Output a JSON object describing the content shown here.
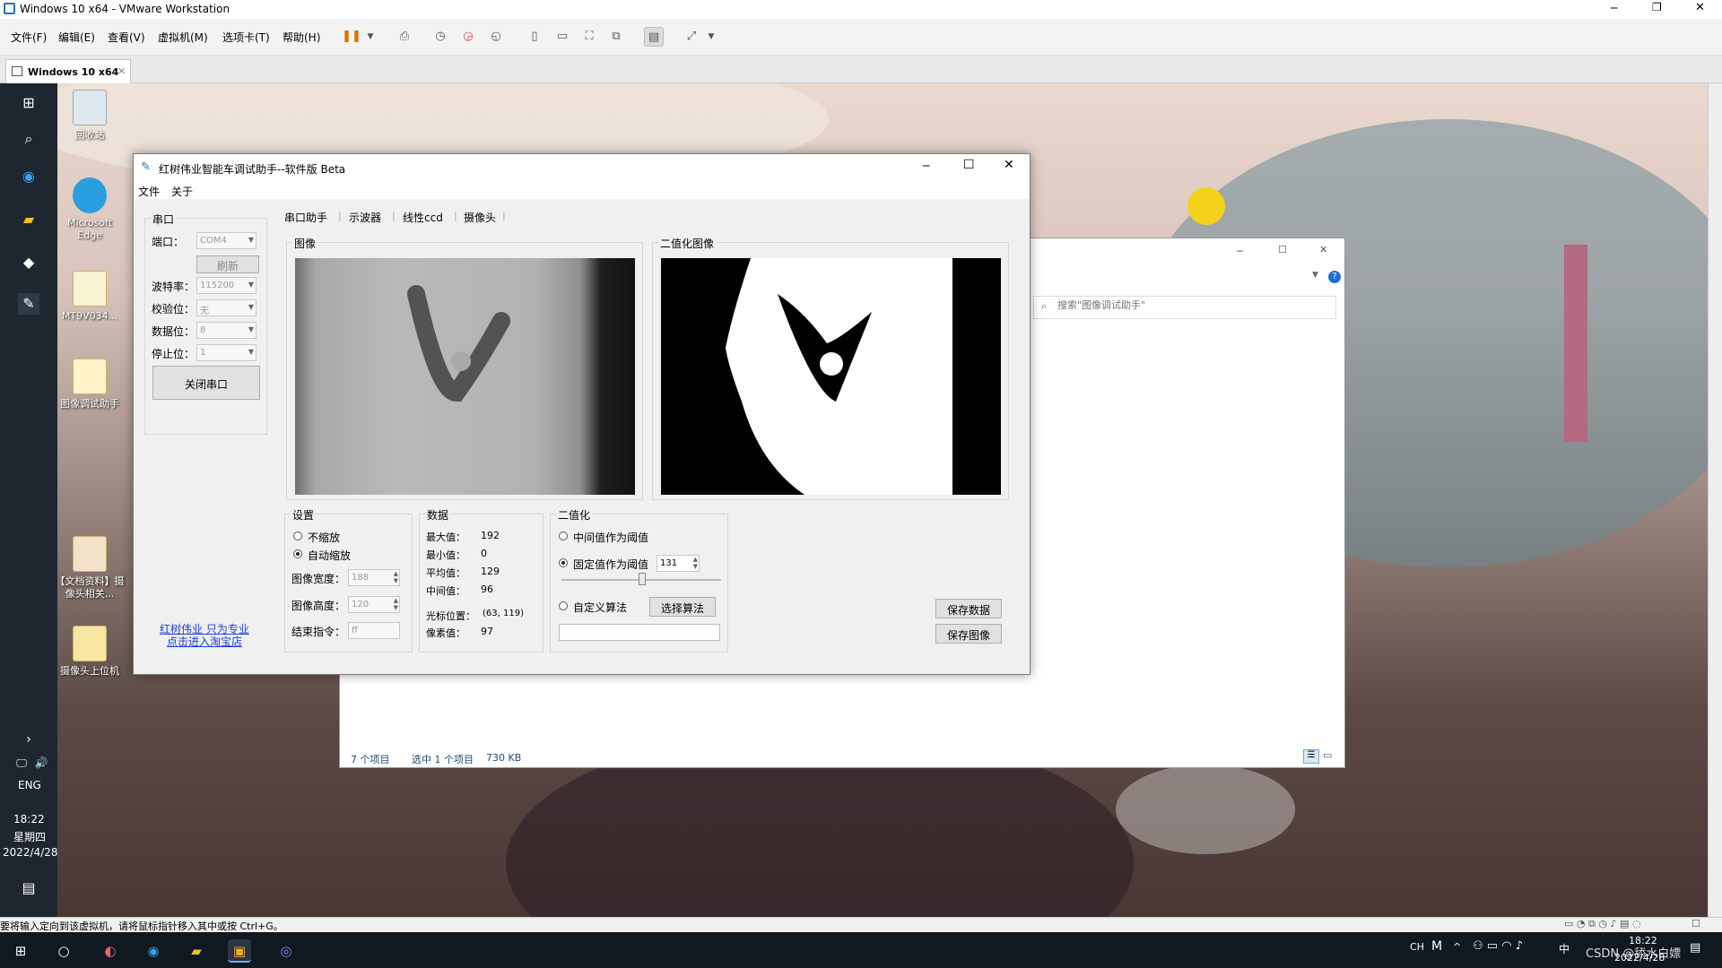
{
  "host": {
    "title": "Windows 10 x64 - VMware Workstation",
    "menu": [
      "文件(F)",
      "编辑(E)",
      "查看(V)",
      "虚拟机(M)",
      "选项卡(T)",
      "帮助(H)"
    ],
    "tab_label": "Windows 10 x64",
    "status_text": "要将输入定向到该虚拟机，请将鼠标指针移入其中或按 Ctrl+G。"
  },
  "guest": {
    "side_lang": "ENG",
    "side_time": "18:22",
    "side_weekday": "星期四",
    "side_date": "2022/4/28",
    "desktop_icons": [
      "回收站",
      "Microsoft Edge",
      "MT9V034...",
      "图像调试助手",
      "【文档资料】摄像头相关...",
      "摄像头上位机"
    ],
    "explorer": {
      "search_placeholder": "搜索\"图像调试助手\"",
      "status_items": "7 个项目",
      "status_selected": "选中 1 个项目",
      "status_size": "730 KB"
    },
    "tray_time": "18:22",
    "tray_date": "2022/4/28",
    "tray_ch": "CH",
    "tray_zh": "中",
    "tray_watermark": "CSDN @舔水白嫖"
  },
  "app": {
    "title": "红树伟业智能车调试助手--软件版 Beta",
    "menu": [
      "文件",
      "关于"
    ],
    "tabs": [
      "串口助手",
      "示波器",
      "线性ccd",
      "摄像头"
    ],
    "serial": {
      "legend": "串口",
      "port_label": "端口：",
      "port_value": "COM4",
      "refresh": "刷新",
      "baud_label": "波特率：",
      "baud_value": "115200",
      "parity_label": "校验位：",
      "parity_value": "无",
      "data_label": "数据位：",
      "data_value": "8",
      "stop_label": "停止位：",
      "stop_value": "1",
      "close_button": "关闭串口"
    },
    "link_line1": "红树伟业 只为专业",
    "link_line2": "点击进入淘宝店",
    "image_legend": "图像",
    "binary_legend": "二值化图像",
    "settings": {
      "legend": "设置",
      "no_scale": "不缩放",
      "auto_scale": "自动缩放",
      "width_label": "图像宽度：",
      "width_value": "188",
      "height_label": "图像高度：",
      "height_value": "120",
      "end_label": "结束指令：",
      "end_value": "ff"
    },
    "data": {
      "legend": "数据",
      "max_label": "最大值：",
      "max_value": "192",
      "min_label": "最小值：",
      "min_value": "0",
      "avg_label": "平均值：",
      "avg_value": "129",
      "median_label": "中间值：",
      "median_value": "96",
      "cursor_label": "光标位置：",
      "cursor_value": "(63, 119)",
      "pixel_label": "像素值：",
      "pixel_value": "97"
    },
    "binarize": {
      "legend": "二值化",
      "median_option": "中间值作为阈值",
      "fixed_option": "固定值作为阈值",
      "fixed_value": "131",
      "custom_option": "自定义算法",
      "choose_button": "选择算法",
      "slider_level": 0.5
    },
    "save_data": "保存数据",
    "save_image": "保存图像"
  }
}
